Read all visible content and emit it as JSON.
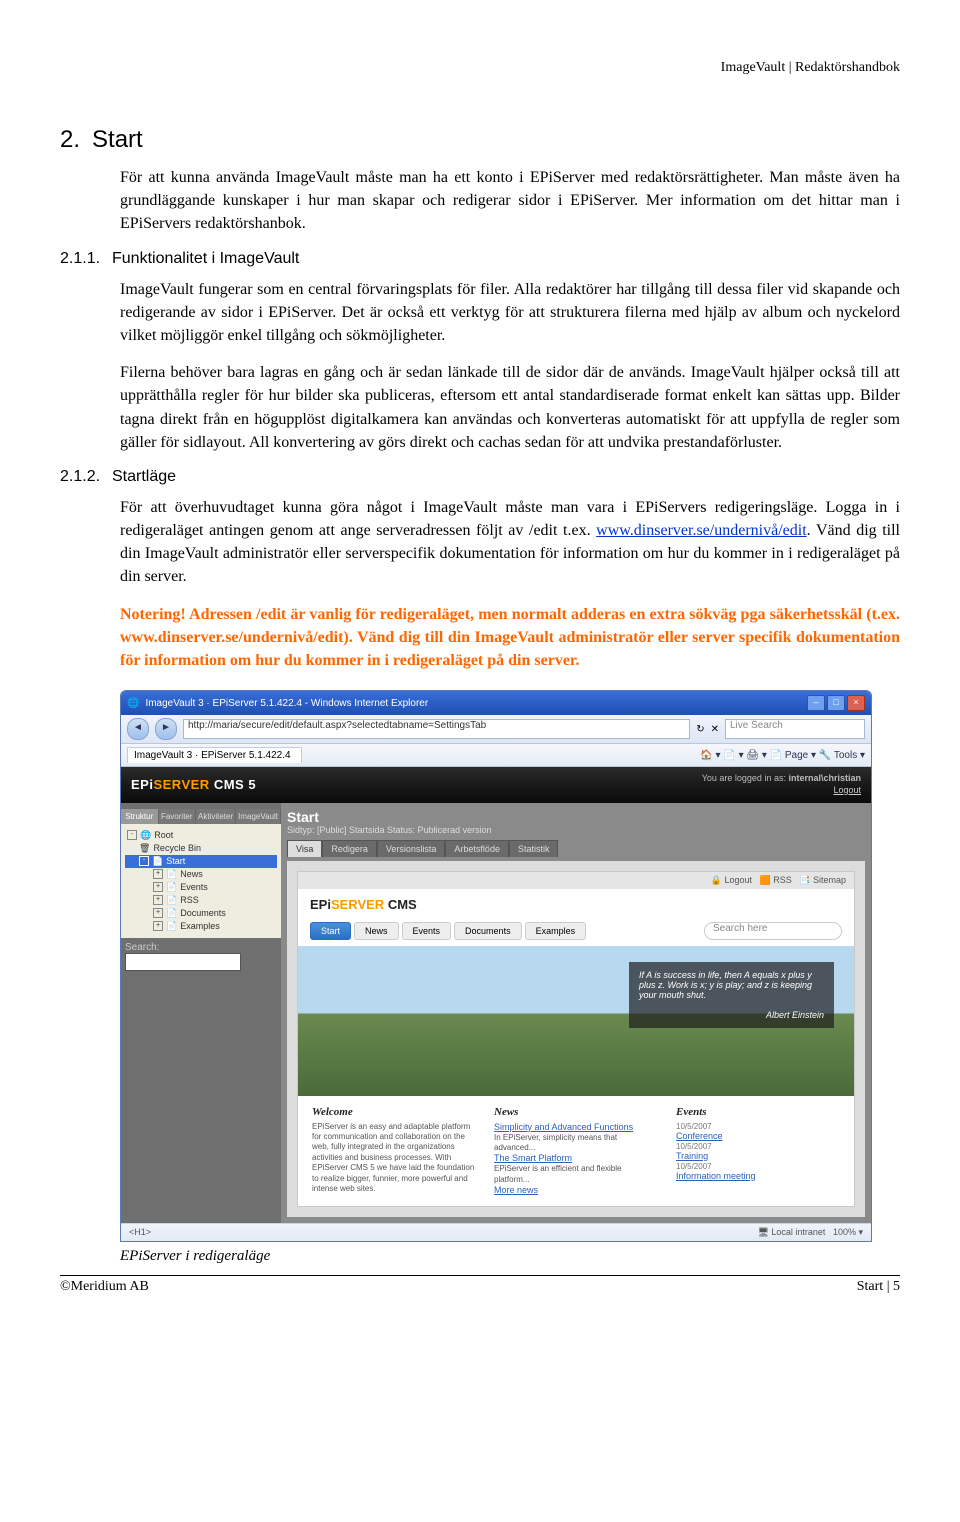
{
  "header_right": "ImageVault | Redaktörshandbok",
  "h1": {
    "num": "2.",
    "title": "Start"
  },
  "intro": "För att kunna använda ImageVault måste man ha ett konto i EPiServer med redaktörsrättigheter. Man måste även ha grundläggande kunskaper i hur man skapar och redigerar sidor i EPiServer. Mer information om det hittar man i EPiServers redaktörshanbok.",
  "s211": {
    "num": "2.1.1.",
    "title": "Funktionalitet i ImageVault"
  },
  "s211_p1": "ImageVault fungerar som en central förvaringsplats för filer. Alla redaktörer har tillgång till dessa filer vid skapande och redigerande av sidor i EPiServer. Det är också ett verktyg för att strukturera filerna med hjälp av album och nyckelord vilket möjliggör enkel tillgång och sökmöjligheter.",
  "s211_p2": "Filerna behöver bara lagras en gång och är sedan länkade till de sidor där de används. ImageVault hjälper också till att upprätthålla regler för hur bilder ska publiceras, eftersom ett antal standardiserade format enkelt kan sättas upp. Bilder tagna direkt från en högupplöst digitalkamera kan användas och konverteras automatiskt för att uppfylla de regler som gäller för sidlayout. All konvertering av görs direkt och cachas sedan för att undvika prestandaförluster.",
  "s212": {
    "num": "2.1.2.",
    "title": "Startläge"
  },
  "s212_p_before_link": "För att överhuvudtaget kunna göra något i ImageVault måste man vara i EPiServers redigeringsläge. Logga in i redigeraläget antingen genom att ange serveradressen följt av /edit t.ex. ",
  "s212_link": "www.dinserver.se/undernivå/edit",
  "s212_p_after_link": ". Vänd dig till din ImageVault administratör eller serverspecifik dokumentation för information om hur du kommer in i redigeraläget på din server.",
  "note": "Notering! Adressen /edit är vanlig för redigeraläget, men normalt adderas en extra sökväg pga säkerhetsskäl (t.ex. www.dinserver.se/undernivå/edit). Vänd dig till din ImageVault administratör eller server specifik dokumentation för information om hur du kommer in i redigeraläget på din server.",
  "shot": {
    "title": "ImageVault 3 · EPiServer 5.1.422.4 - Windows Internet Explorer",
    "url": "http://maria/secure/edit/default.aspx?selectedtabname=SettingsTab",
    "search_placeholder": "Live Search",
    "tab": "ImageVault 3 · EPiServer 5.1.422.4",
    "tools": "🏠 ▾   📄 ▾   🖨 ▾   📄 Page ▾   🔧 Tools ▾",
    "epi_logo_1": "EPi",
    "epi_logo_2": "SERVER",
    "epi_logo_3": " CMS 5",
    "logged_in_label": "You are logged in as:",
    "logged_in_user": "internal\\christian",
    "logout": "Logout",
    "side_tabs": [
      "Struktur",
      "Favoriter",
      "Aktiviteter",
      "ImageVault"
    ],
    "tree": [
      "Root",
      "Recycle Bin",
      "Start",
      "News",
      "Events",
      "RSS",
      "Documents",
      "Examples"
    ],
    "search_label": "Search:",
    "content_heading": "Start",
    "content_meta": "Sidtyp: [Public] Startsida   Status: Publicerad version",
    "content_tabs": [
      "Visa",
      "Redigera",
      "Versionslista",
      "Arbetsflöde",
      "Statistik"
    ],
    "toplinks": [
      "Logout",
      "RSS",
      "Sitemap"
    ],
    "nav": [
      "Start",
      "News",
      "Events",
      "Documents",
      "Examples"
    ],
    "search_here": "Search here",
    "quote": "If A is success in life, then A equals x plus y plus z. Work is x; y is play; and z is keeping your mouth shut.",
    "quote_author": "Albert Einstein",
    "cols": {
      "welcome": {
        "h": "Welcome",
        "p": "EPiServer is an easy and adaptable platform for communication and collaboration on the web, fully integrated in the organizations activities and business processes. With EPiServer CMS 5 we have laid the foundation to realize bigger, funnier, more powerful and intense web sites."
      },
      "news": {
        "h": "News",
        "items": [
          {
            "t": "Simplicity and Advanced Functions",
            "d": "In EPiServer, simplicity means that advanced..."
          },
          {
            "t": "The Smart Platform",
            "d": "EPiServer is an efficient and flexible platform..."
          }
        ],
        "more": "More news"
      },
      "events": {
        "h": "Events",
        "items": [
          {
            "date": "10/5/2007",
            "t": "Conference"
          },
          {
            "date": "10/5/2007",
            "t": "Training"
          },
          {
            "date": "10/5/2007",
            "t": "Information meeting"
          }
        ]
      }
    },
    "status_left": "<H1>",
    "status_mid": "Local intranet",
    "status_right": "100% ▾"
  },
  "caption": "EPiServer i redigeraläge",
  "footer_left": "©Meridium AB",
  "footer_right": "Start |  5"
}
